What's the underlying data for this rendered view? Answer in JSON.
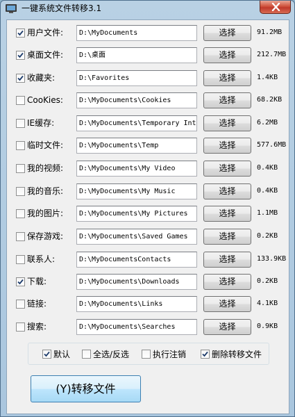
{
  "window": {
    "title": "一键系统文件转移3.1"
  },
  "rows": [
    {
      "label": "用户文件:",
      "checked": true,
      "path": "D:\\MyDocuments",
      "button": "选择",
      "size": "91.2MB"
    },
    {
      "label": "桌面文件:",
      "checked": true,
      "path": "D:\\桌面",
      "button": "选择",
      "size": "212.7MB"
    },
    {
      "label": "收藏夹:",
      "checked": true,
      "path": "D:\\Favorites",
      "button": "选择",
      "size": "1.4KB"
    },
    {
      "label": "CooKies:",
      "checked": false,
      "path": "D:\\MyDocuments\\Cookies",
      "button": "选择",
      "size": "68.2KB"
    },
    {
      "label": "IE缓存:",
      "checked": false,
      "path": "D:\\MyDocuments\\Temporary Inte",
      "button": "选择",
      "size": "6.2MB"
    },
    {
      "label": "临时文件:",
      "checked": false,
      "path": "D:\\MyDocuments\\Temp",
      "button": "选择",
      "size": "577.6MB"
    },
    {
      "label": "我的视频:",
      "checked": false,
      "path": "D:\\MyDocuments\\My Video",
      "button": "选择",
      "size": "0.4KB"
    },
    {
      "label": "我的音乐:",
      "checked": false,
      "path": "D:\\MyDocuments\\My Music",
      "button": "选择",
      "size": "0.4KB"
    },
    {
      "label": "我的图片:",
      "checked": false,
      "path": "D:\\MyDocuments\\My Pictures",
      "button": "选择",
      "size": "1.1MB"
    },
    {
      "label": "保存游戏:",
      "checked": false,
      "path": "D:\\MyDocuments\\Saved Games",
      "button": "选择",
      "size": "0.2KB"
    },
    {
      "label": "联系人:",
      "checked": false,
      "path": "D:\\MyDocumentsContacts",
      "button": "选择",
      "size": "133.9KB"
    },
    {
      "label": "下载:",
      "checked": true,
      "path": "D:\\MyDocuments\\Downloads",
      "button": "选择",
      "size": "0.2KB"
    },
    {
      "label": "链接:",
      "checked": false,
      "path": "D:\\MyDocuments\\Links",
      "button": "选择",
      "size": "4.1KB"
    },
    {
      "label": "搜索:",
      "checked": false,
      "path": "D:\\MyDocuments\\Searches",
      "button": "选择",
      "size": "0.9KB"
    }
  ],
  "options": [
    {
      "label": "默认",
      "checked": true
    },
    {
      "label": "全选/反选",
      "checked": false
    },
    {
      "label": "执行注销",
      "checked": false
    },
    {
      "label": "删除转移文件",
      "checked": true
    }
  ],
  "transfer_button": "(Y)转移文件"
}
